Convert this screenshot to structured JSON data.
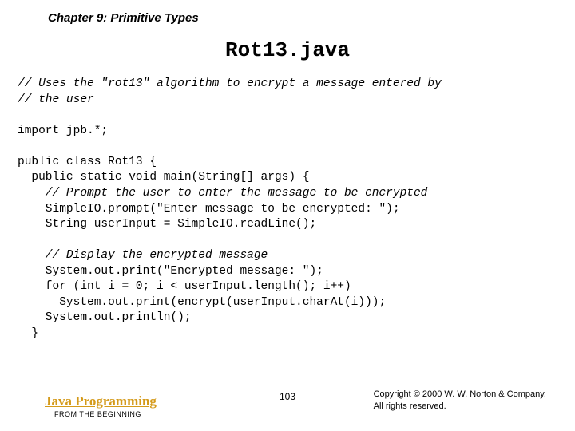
{
  "chapter": "Chapter 9: Primitive Types",
  "title": "Rot13.java",
  "code": {
    "c1": "// Uses the \"rot13\" algorithm to encrypt a message entered by",
    "c2": "// the user",
    "c3": "import jpb.*;",
    "c4": "public class Rot13 {",
    "c5": "  public static void main(String[] args) {",
    "c6": "    // Prompt the user to enter the message to be encrypted",
    "c7": "    SimpleIO.prompt(\"Enter message to be encrypted: \");",
    "c8": "    String userInput = SimpleIO.readLine();",
    "c9": "    // Display the encrypted message",
    "c10": "    System.out.print(\"Encrypted message: \");",
    "c11": "    for (int i = 0; i < userInput.length(); i++)",
    "c12": "      System.out.print(encrypt(userInput.charAt(i)));",
    "c13": "    System.out.println();",
    "c14": "  }"
  },
  "footer": {
    "left_title": "Java Programming",
    "left_sub": "FROM THE BEGINNING",
    "page": "103",
    "copyright_line1": "Copyright © 2000 W. W. Norton & Company.",
    "copyright_line2": "All rights reserved."
  }
}
